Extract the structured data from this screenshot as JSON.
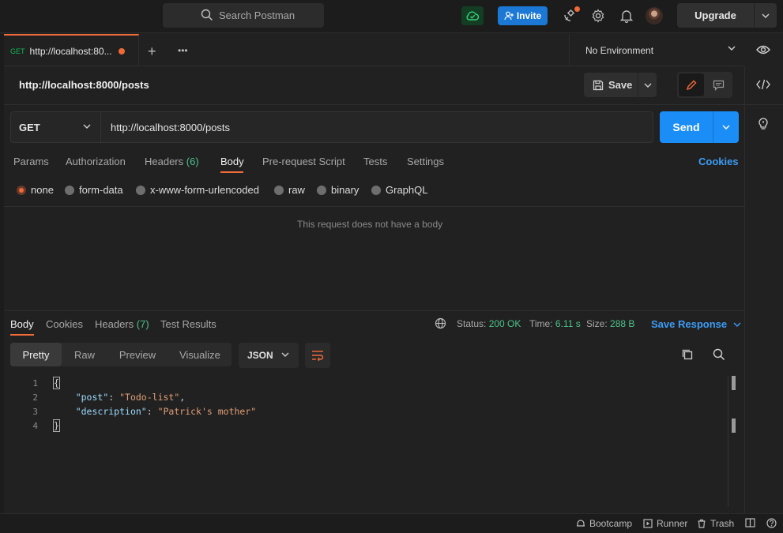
{
  "topbar": {
    "search_placeholder": "Search Postman",
    "invite_label": "Invite",
    "upgrade_label": "Upgrade"
  },
  "tabs": [
    {
      "method": "GET",
      "title": "http://localhost:80..."
    }
  ],
  "environment": {
    "selected": "No Environment"
  },
  "request": {
    "name": "http://localhost:8000/posts",
    "save_label": "Save",
    "method": "GET",
    "url": "http://localhost:8000/posts",
    "send_label": "Send",
    "tabs": {
      "params": "Params",
      "authorization": "Authorization",
      "headers": "Headers",
      "headers_count": "(6)",
      "body": "Body",
      "prerequest": "Pre-request Script",
      "tests": "Tests",
      "settings": "Settings"
    },
    "cookies_label": "Cookies",
    "body_types": [
      "none",
      "form-data",
      "x-www-form-urlencoded",
      "raw",
      "binary",
      "GraphQL"
    ],
    "body_type_selected": "none",
    "no_body_message": "This request does not have a body"
  },
  "response": {
    "tabs": {
      "body": "Body",
      "cookies": "Cookies",
      "headers": "Headers",
      "headers_count": "(7)",
      "test_results": "Test Results"
    },
    "status_label": "Status:",
    "status_value": "200 OK",
    "time_label": "Time:",
    "time_value": "6.11 s",
    "size_label": "Size:",
    "size_value": "288 B",
    "save_response_label": "Save Response",
    "views": [
      "Pretty",
      "Raw",
      "Preview",
      "Visualize"
    ],
    "view_selected": "Pretty",
    "format": "JSON",
    "lines": [
      {
        "n": "1",
        "text": "{"
      },
      {
        "n": "2",
        "key": "\"post\"",
        "value": "\"Todo-list\"",
        "trail": ","
      },
      {
        "n": "3",
        "key": "\"description\"",
        "value": "\"Patrick's mother\"",
        "trail": ""
      },
      {
        "n": "4",
        "text": "}"
      }
    ]
  },
  "footer": {
    "bootcamp": "Bootcamp",
    "runner": "Runner",
    "trash": "Trash"
  },
  "colors": {
    "accent_orange": "#f26b3a",
    "primary_blue": "#1a8df7",
    "status_green": "#4cc38a"
  }
}
